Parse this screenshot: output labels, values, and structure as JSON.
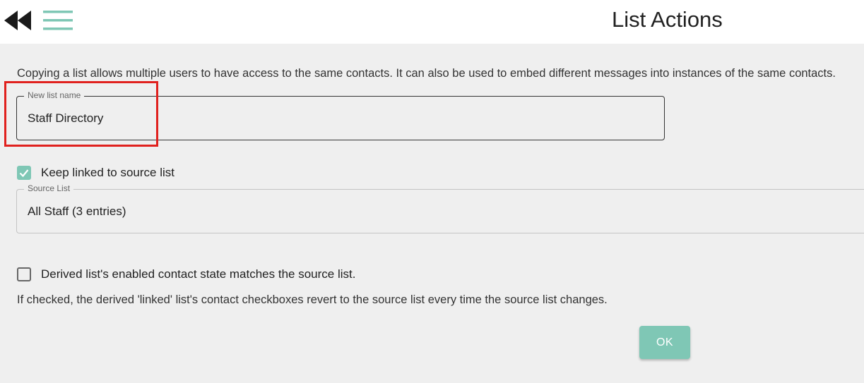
{
  "header": {
    "back_icon": "rewind-double-arrow-icon",
    "menu_icon": "hamburger-menu-icon",
    "title": "List Actions"
  },
  "intro_text": "Copying a list allows multiple users to have access to the same contacts. It can also be used to embed different messages into instances of the same contacts.",
  "new_list": {
    "label": "New list name",
    "value": "Staff Directory"
  },
  "keep_linked": {
    "label": "Keep linked to source list",
    "checked": true
  },
  "source_list": {
    "label": "Source List",
    "value": "All Staff (3 entries)"
  },
  "derived_state": {
    "label": "Derived list's enabled contact state matches the source list.",
    "checked": false,
    "help": "If checked, the derived 'linked' list's contact checkboxes revert to the source list every time the source list changes."
  },
  "ok_button": "OK",
  "colors": {
    "accent": "#7fc7b5",
    "highlight": "#e0211e",
    "background": "#efefef"
  }
}
